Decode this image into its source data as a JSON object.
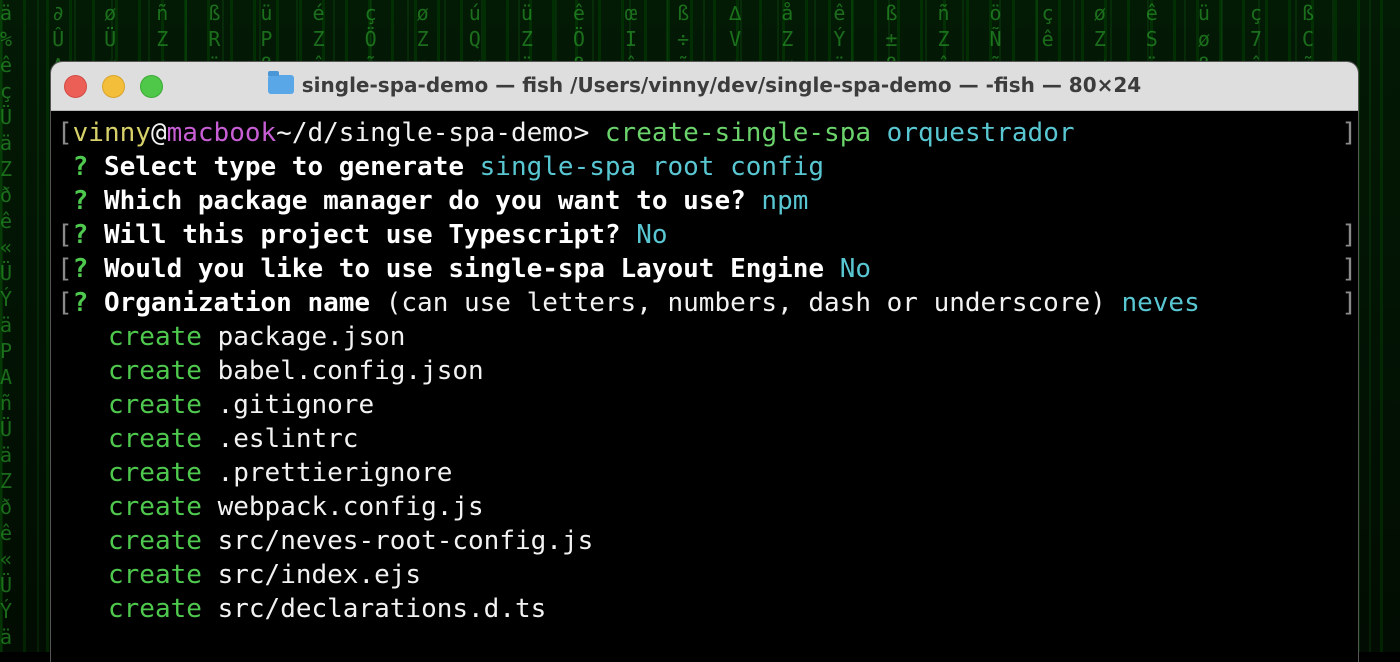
{
  "window": {
    "title": "single-spa-demo — fish /Users/vinny/dev/single-spa-demo — -fish — 80×24",
    "folder_icon": "folder-icon"
  },
  "prompt": {
    "user": "vinny",
    "at": "@",
    "host": "macbook",
    "path": "~/d/single-spa-demo>",
    "command": "create-single-spa",
    "argument": "orquestrador"
  },
  "questions": [
    {
      "mark": "?",
      "text": "Select type to generate",
      "extra": "",
      "answer": "single-spa root config"
    },
    {
      "mark": "?",
      "text": "Which package manager do you want to use?",
      "extra": "",
      "answer": "npm"
    },
    {
      "mark": "?",
      "text": "Will this project use Typescript?",
      "extra": "",
      "answer": "No"
    },
    {
      "mark": "?",
      "text": "Would you like to use single-spa Layout Engine",
      "extra": "",
      "answer": "No"
    },
    {
      "mark": "?",
      "text": "Organization name",
      "extra": "(can use letters, numbers, dash or underscore)",
      "answer": "neves"
    }
  ],
  "created_files": [
    {
      "verb": "create",
      "file": "package.json"
    },
    {
      "verb": "create",
      "file": "babel.config.json"
    },
    {
      "verb": "create",
      "file": ".gitignore"
    },
    {
      "verb": "create",
      "file": ".eslintrc"
    },
    {
      "verb": "create",
      "file": ".prettierignore"
    },
    {
      "verb": "create",
      "file": "webpack.config.js"
    },
    {
      "verb": "create",
      "file": "src/neves-root-config.js"
    },
    {
      "verb": "create",
      "file": "src/index.ejs"
    },
    {
      "verb": "create",
      "file": "src/declarations.d.ts"
    }
  ],
  "colors": {
    "prompt_user": "#d7d16a",
    "prompt_host": "#c75ed4",
    "command": "#6bd36b",
    "answer": "#59c7d2",
    "create": "#4ec94e"
  }
}
